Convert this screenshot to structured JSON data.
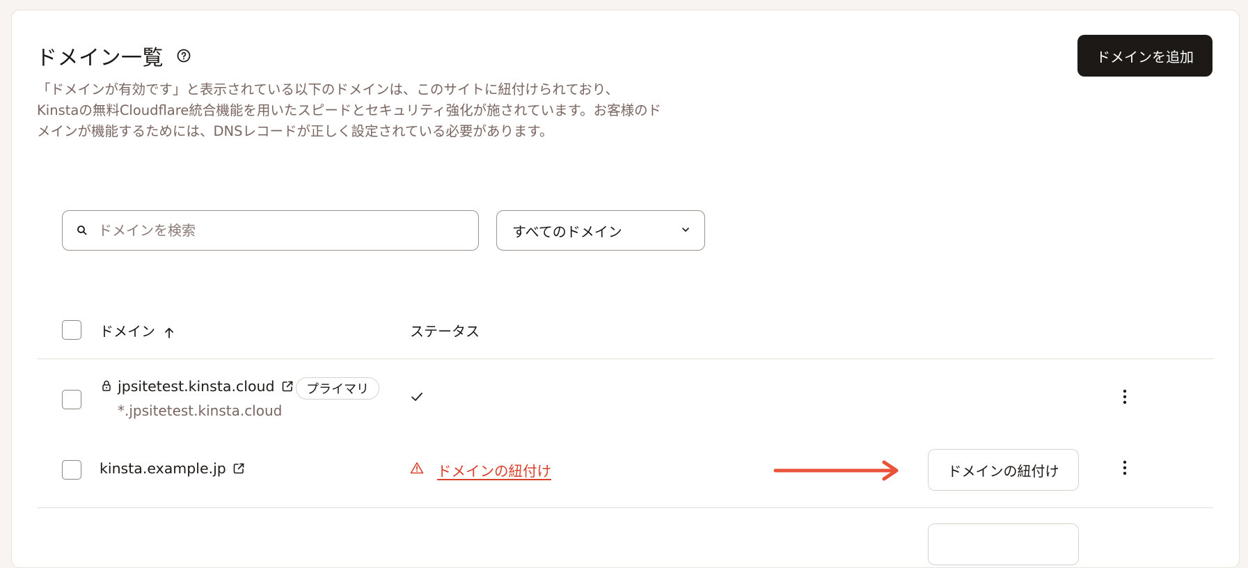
{
  "header": {
    "title": "ドメイン一覧",
    "add_button_label": "ドメインを追加"
  },
  "description": {
    "line1": "「ドメインが有効です」と表示されている以下のドメインは、このサイトに紐付けられており、",
    "line2": "Kinstaの無料Cloudflare統合機能を用いたスピードとセキュリティ強化が施されています。お客様のド",
    "line3": "メインが機能するためには、DNSレコードが正しく設定されている必要があります。"
  },
  "filters": {
    "search_placeholder": "ドメインを検索",
    "domain_select_value": "すべてのドメイン"
  },
  "table": {
    "columns": {
      "domain": "ドメイン",
      "status": "ステータス"
    },
    "rows": [
      {
        "domain": "jpsitetest.kinsta.cloud",
        "badge": "プライマリ",
        "wildcard": "*.jpsitetest.kinsta.cloud",
        "status_icon": "checkmark-icon"
      },
      {
        "domain": "kinsta.example.jp",
        "status_text": "ドメインの紐付け",
        "status_icon": "warning-icon",
        "action_label": "ドメインの紐付け"
      }
    ]
  },
  "colors": {
    "accent_dark": "#1c1917",
    "warning": "#d9412b",
    "annotation_arrow": "#e8533a",
    "muted_text": "#7a6661"
  }
}
